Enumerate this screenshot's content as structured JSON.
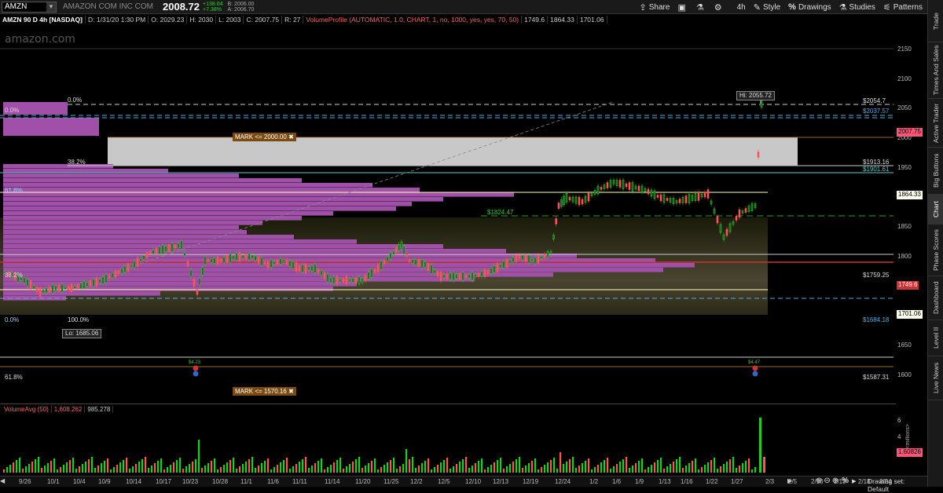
{
  "header": {
    "symbol": "AMZN",
    "company": "AMAZON COM INC COM",
    "last": "2008.72",
    "change_up": "+138.04",
    "change_pct": "+7.38%",
    "bid": "B: 2006.00",
    "ask": "A: 2006.70"
  },
  "toolbar": {
    "share": "Share",
    "timeframe": "4h",
    "style": "Style",
    "drawings": "Drawings",
    "studies": "Studies",
    "patterns": "Patterns"
  },
  "info": {
    "title": "AMZN 90 D 4h [NASDAQ]",
    "date": "D: 1/31/20 1:30 PM",
    "open": "O: 2029.23",
    "high": "H: 2030",
    "low": "L: 2003",
    "close": "C: 2007.75",
    "range": "R: 27",
    "vp": "VolumeProfile (AUTOMATIC, 1.0, CHART, 1, no, 1000, yes, yes, 70, 50)",
    "vp1": "1749.6",
    "vp2": "1864.33",
    "vp3": "1701.06"
  },
  "watermark": "amazon.com",
  "side_tabs": [
    "Trade",
    "Times And Sales",
    "Active Trader",
    "Big Buttons",
    "Chart",
    "Phase Scores",
    "Dashboard",
    "Level II",
    "Live News"
  ],
  "price_axis": [
    "2150",
    "2100",
    "2050",
    "2000",
    "1950",
    "1900",
    "1850",
    "1800",
    "1750",
    "1700",
    "1650",
    "1600"
  ],
  "level_labels": {
    "l2054": "$2054.7",
    "l2037": "$2037.57",
    "l1913": "$1913.16",
    "l1901": "$1901.61",
    "l1759": "$1759.25",
    "l1684": "$1684.18",
    "l1587": "$1587.31",
    "l1824": "$1824.47"
  },
  "tags": {
    "last": "2007.75",
    "poc": "1749.6",
    "vah": "1864.33",
    "val": "1701.06",
    "vol_last": "1.60826"
  },
  "fib": {
    "f0_top": "0.0%",
    "f0_left": "0.0%",
    "f382_top": "38.2%",
    "f618_left": "61.8%",
    "f382_left": "38.2%",
    "f0_bottom": "0.0%",
    "f100": "100.0%",
    "f618_bottom": "61.8%"
  },
  "callouts": {
    "hi": "Hi: 2055.72",
    "lo": "Lo: 1685.06",
    "mark1": "MARK <= 2000.00",
    "mark2": "MARK <= 1570.16"
  },
  "earnings": {
    "e1": "$4.23",
    "e2": "$4.47"
  },
  "volume": {
    "title": "VolumeAvg (50)",
    "v1": "1,608.262",
    "v2": "985.278",
    "axis": [
      "6",
      "4",
      "2"
    ],
    "unit": "<millions>"
  },
  "dates": [
    "9/26",
    "10/1",
    "10/4",
    "10/9",
    "10/14",
    "10/17",
    "10/23",
    "10/28",
    "11/1",
    "11/6",
    "11/11",
    "11/14",
    "11/20",
    "11/25",
    "12/2",
    "12/5",
    "12/10",
    "12/13",
    "12/19",
    "12/24",
    "1/2",
    "1/6",
    "1/9",
    "1/13",
    "1/16",
    "1/22",
    "1/27",
    "2/3",
    "2/5",
    "2/10",
    "2/13",
    "2/18",
    "2/24"
  ],
  "bottom": {
    "drawing_set": "Drawing set: Default"
  }
}
